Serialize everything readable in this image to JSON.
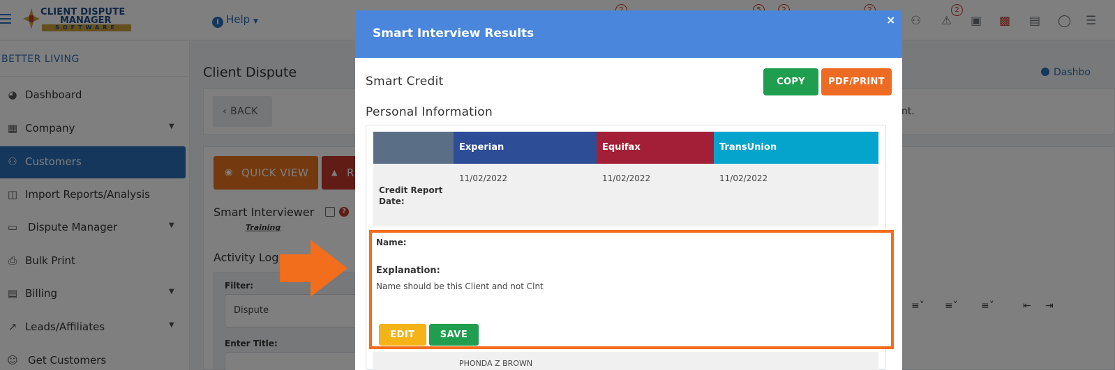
{
  "app": {
    "logo": {
      "line1": "CLIENT DISPUTE",
      "line2": "MANAGER",
      "line3": "SOFTWARE"
    },
    "help_label": "Help",
    "badges": [
      "2",
      "5",
      "2",
      "2",
      "2"
    ],
    "company_name": "BETTER LIVING"
  },
  "sidebar": {
    "items": [
      {
        "label": "Dashboard",
        "icon": "chart-pie-icon",
        "caret": false
      },
      {
        "label": "Company",
        "icon": "building-icon",
        "caret": true
      },
      {
        "label": "Customers",
        "icon": "users-icon",
        "caret": false,
        "active": true
      },
      {
        "label": "Import Reports/Analysis",
        "icon": "file-import-icon",
        "caret": false
      },
      {
        "label": "Dispute Manager",
        "icon": "laptop-icon",
        "caret": true
      },
      {
        "label": "Bulk Print",
        "icon": "print-icon",
        "caret": false
      },
      {
        "label": "Billing",
        "icon": "invoice-icon",
        "caret": true
      },
      {
        "label": "Leads/Affiliates",
        "icon": "chart-line-icon",
        "caret": true
      },
      {
        "label": "Get Customers",
        "icon": "user-plus-icon",
        "caret": false
      }
    ]
  },
  "page": {
    "title": "Client Dispute",
    "back_label": "BACK",
    "dashboard_link": "Dashbo",
    "right_text": "nt.",
    "quick_view_label": "QUICK VIEW",
    "red_btn_label": "R",
    "smart_interviewer_label": "Smart Interviewer",
    "training_label": "Training",
    "activity_label": "Activity Log",
    "filter_label": "Filter:",
    "filter_value": "Dispute",
    "enter_title_label": "Enter Title:"
  },
  "modal": {
    "title": "Smart Interview Results",
    "close_symbol": "×",
    "provider": "Smart Credit",
    "copy_label": "COPY",
    "pdf_label": "PDF/PRINT",
    "section_title": "Personal Information",
    "bureaus": [
      "Experian",
      "Equifax",
      "TransUnion"
    ],
    "bureau_colors": [
      "#2e4d97",
      "#a31f37",
      "#05a4cd"
    ],
    "date_row": {
      "label": "Credit Report Date:",
      "values": [
        "11/02/2022",
        "11/02/2022",
        "11/02/2022"
      ]
    },
    "name_block": {
      "name_label": "Name:",
      "explanation_label": "Explanation:",
      "explanation_text": "Name should be this Client and not Clnt",
      "edit_label": "EDIT",
      "save_label": "SAVE"
    },
    "next_row_text": "PHONDA Z BROWN"
  }
}
